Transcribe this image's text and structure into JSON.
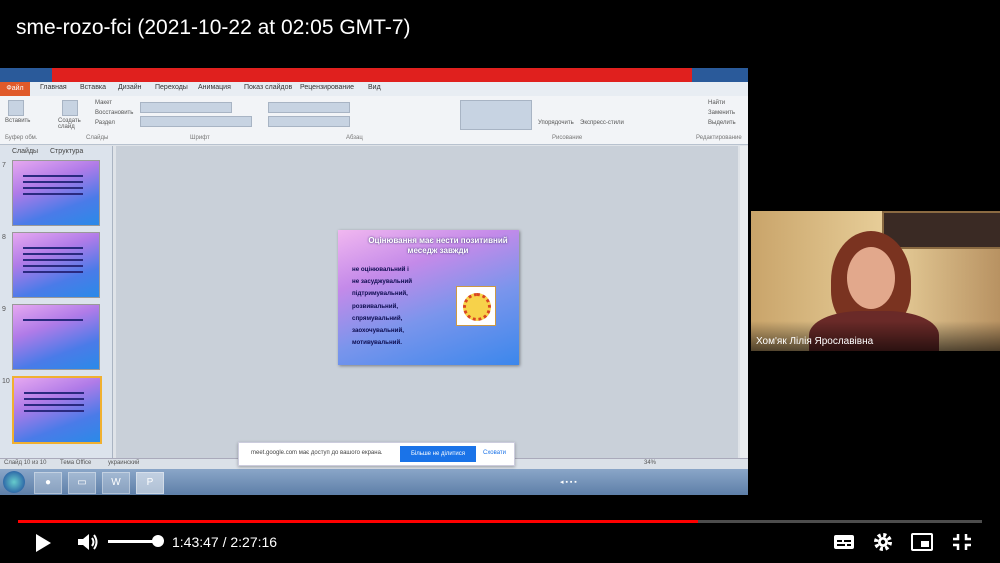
{
  "video": {
    "title": "sme-rozo-fci (2021-10-22 at 02:05 GMT-7)",
    "current_time": "1:43:47",
    "duration": "2:27:16",
    "time_display": "1:43:47 / 2:27:16",
    "progress_fraction": 0.705,
    "volume_fraction": 1.0
  },
  "presentation": {
    "window_title": "",
    "file_tab": "Файл",
    "tabs": [
      "Главная",
      "Вставка",
      "Дизайн",
      "Переходы",
      "Анимация",
      "Показ слайдов",
      "Рецензирование",
      "Вид"
    ],
    "ribbon_groups": [
      "Буфер обм.",
      "Слайды",
      "Шрифт",
      "Абзац",
      "Рисование",
      "Редактирование"
    ],
    "ribbon_buttons": {
      "paste": "Вставить",
      "new_slide": "Создать слайд",
      "layout": "Макет",
      "reset": "Восстановить",
      "section": "Раздел",
      "arrange": "Упорядочить",
      "quick_styles": "Экспресс-стили",
      "find": "Найти",
      "replace": "Заменить",
      "select": "Выделить"
    },
    "panel_tabs": [
      "Слайды",
      "Структура"
    ],
    "slide_numbers": [
      "7",
      "8",
      "9",
      "10"
    ],
    "current_slide": {
      "title": "Оцінювання має нести позитивний меседж завжди",
      "bullets": [
        "не оцінювальний і",
        "не засуджувальний",
        "підтримувальний,",
        "розвивальний,",
        "спрямувальний,",
        "заохочувальний,",
        "мотивувальний."
      ]
    },
    "status": {
      "slide": "Слайд 10 из 10",
      "theme": "Тема Office",
      "language": "украинский",
      "zoom": "34%"
    }
  },
  "meet_notice": {
    "text": "meet.google.com має доступ до вашого екрана.",
    "stop_button": "Більше не ділитися",
    "hide_button": "Сховати"
  },
  "participant": {
    "name": "Хом'як Лілія Ярославівна"
  },
  "icons": [
    "play-icon",
    "volume-icon",
    "subtitles-icon",
    "settings-icon",
    "miniplayer-icon",
    "exit-fullscreen-icon"
  ],
  "colors": {
    "progress": "#ff0000",
    "background": "#000000",
    "slide_text": "#0d0d50"
  }
}
